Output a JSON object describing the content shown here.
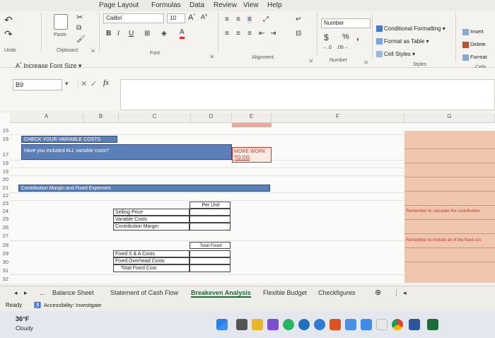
{
  "ribbon_tabs": [
    "Page Layout",
    "Formulas",
    "Data",
    "Review",
    "View",
    "Help"
  ],
  "ribbon": {
    "undo_label": "Undo",
    "clipboard_label": "Clipboard",
    "paste_label": "Paste",
    "font_group_label": "Font",
    "font_name": "Calibri",
    "font_size": "10",
    "bold": "B",
    "italic": "I",
    "underline": "U",
    "alignment_label": "Alignment",
    "number_format": "Number",
    "currency": "$",
    "percent": "%",
    "comma": ",",
    "number_label": "Number",
    "conditional_formatting": "Conditional Formatting",
    "format_as_table": "Format as Table",
    "cell_styles": "Cell Styles",
    "styles_label": "Styles",
    "insert": "Insert",
    "delete": "Delete",
    "format": "Format",
    "cells_label": "Cells",
    "increase_font_size": "Increase Font Size"
  },
  "formula_bar": {
    "name_box": "B9",
    "fx": "fx",
    "content": ""
  },
  "grid": {
    "columns": [
      "A",
      "B",
      "C",
      "D",
      "E",
      "F",
      "G"
    ],
    "rows": [
      "15",
      "16",
      "17",
      "18",
      "19",
      "20",
      "21",
      "22",
      "23",
      "24",
      "25",
      "26",
      "27",
      "28",
      "29",
      "30",
      "31",
      "32"
    ],
    "check_variable_costs": "CHECK YOUR VARIABLE COSTS",
    "have_you_included": "Have you included ALL variable costs?",
    "more_work": "MORE WORK",
    "to_do": "TO DO",
    "contribution_margin_header": "Contribution Margin and Fixed Expenses",
    "per_unit": "Per Unit",
    "selling_price": "Selling Price",
    "variable_costs": "Variable Costs",
    "contribution_margin": "Contribution Margin",
    "total_fixed_expense": "Total Fixed Expense",
    "fixed_sga_costs": "Fixed S & A Costs",
    "fixed_overhead_costs": "Fixed Overhead Costs",
    "total_fixed_cost": "Total Fixed Cost",
    "remember_contribution": "Remember to calculate the contribution",
    "remember_include": "Remember to include all of the fixed cos"
  },
  "sheet_tabs": {
    "ellipsis": "...",
    "tabs": [
      "Balance Sheet",
      "Statement of Cash Flow",
      "Breakeven Analysis",
      "Flexible Budget",
      "Checkfigures"
    ],
    "active": "Breakeven Analysis"
  },
  "status": {
    "ready": "Ready",
    "accessibility": "Accessibility: Investigate"
  },
  "taskbar": {
    "temperature": "36°F",
    "weather": "Cloudy"
  },
  "colors": {
    "band_blue": "#5b7fb8",
    "salmon": "#f1c6ae",
    "active_tab_green": "#1e6b3a",
    "warning_red": "#c0392b"
  }
}
